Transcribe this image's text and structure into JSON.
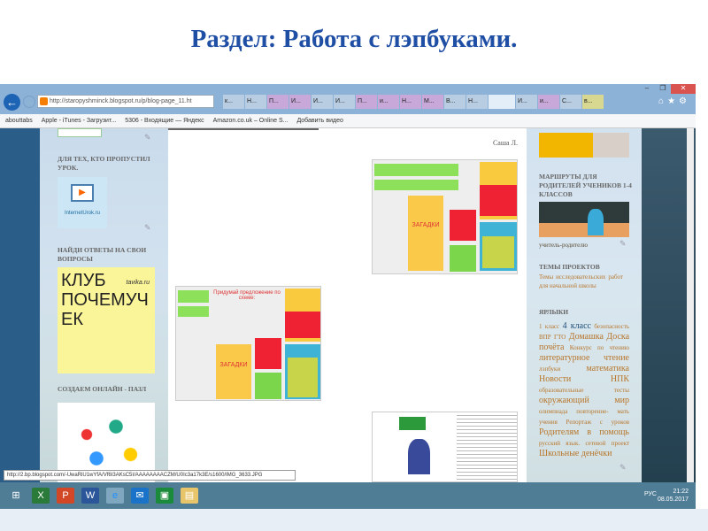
{
  "slide": {
    "title": "Раздел: Работа с лэпбуками."
  },
  "browser": {
    "url": "http://staropyshminck.blogspot.ru/p/blog-page_11.ht",
    "tabs": [
      "к...",
      "Н...",
      "П...",
      "И...",
      "И...",
      "И...",
      "П...",
      "и...",
      "Н...",
      "М...",
      "В...",
      "Н...",
      "",
      "И...",
      "и...",
      "С...",
      "в..."
    ],
    "bookmarks": [
      "abouttabs",
      "Apple - iTunes - Загрузит...",
      "5306 - Входящие — Яндекс",
      "Amazon.co.uk – Online S...",
      "Добавить видео"
    ],
    "status_url": "http://2.bp.blogspot.com/-UwaRiU1wYfA/Vf6I3AKsC5I/AAAAAAAACZM/U0Ic3a17k3E/s1600/IMG_3633.JPG"
  },
  "left_sidebar": {
    "sections": [
      {
        "heading": "ДЛЯ ТЕХ, КТО ПРОПУСТИЛ УРОК.",
        "image_text": "InternetUrok.ru"
      },
      {
        "heading": "НАЙДИ ОТВЕТЫ НА СВОИ ВОПРОСЫ",
        "image_text": "КЛУБ ПОЧЕМУЧЕК",
        "image_sub": "tavika.ru"
      },
      {
        "heading": "СОЗДАЕМ ОНЛАЙН - ПАЗЛ"
      }
    ]
  },
  "main": {
    "author": "Саша Л.",
    "lapbook_labels": {
      "riddles": "ЗАГАДКИ",
      "scheme": "Придумай предложение по схеме:"
    }
  },
  "right_sidebar": {
    "routes_heading": "МАРШРУТЫ ДЛЯ РОДИТЕЛЕЙ УЧЕНИКОВ 1-4 КЛАССОВ",
    "routes_link": "учитель-родителю",
    "projects_heading": "ТЕМЫ ПРОЕКТОВ",
    "projects_link": "Темы исследовательских работ для начальной школы",
    "labels_heading": "ЯРЛЫКИ",
    "labels": [
      "1 класс",
      "4 класс",
      "безопасность",
      "ВПР",
      "ГТО",
      "Домашка",
      "Доска почёта",
      "Конкурс по чтению",
      "литературное чтение",
      "лэпбуки",
      "математика",
      "Новости",
      "НПК",
      "образовательные тесты",
      "окружающий мир",
      "олимпиада",
      "повторение- мать учения",
      "Репортаж с уроков",
      "Родителям в помощь",
      "русский язык.",
      "сетевой проект",
      "Школьные денёчки"
    ]
  },
  "taskbar": {
    "lang": "РУС",
    "time": "21:22",
    "date": "08.05.2017"
  }
}
